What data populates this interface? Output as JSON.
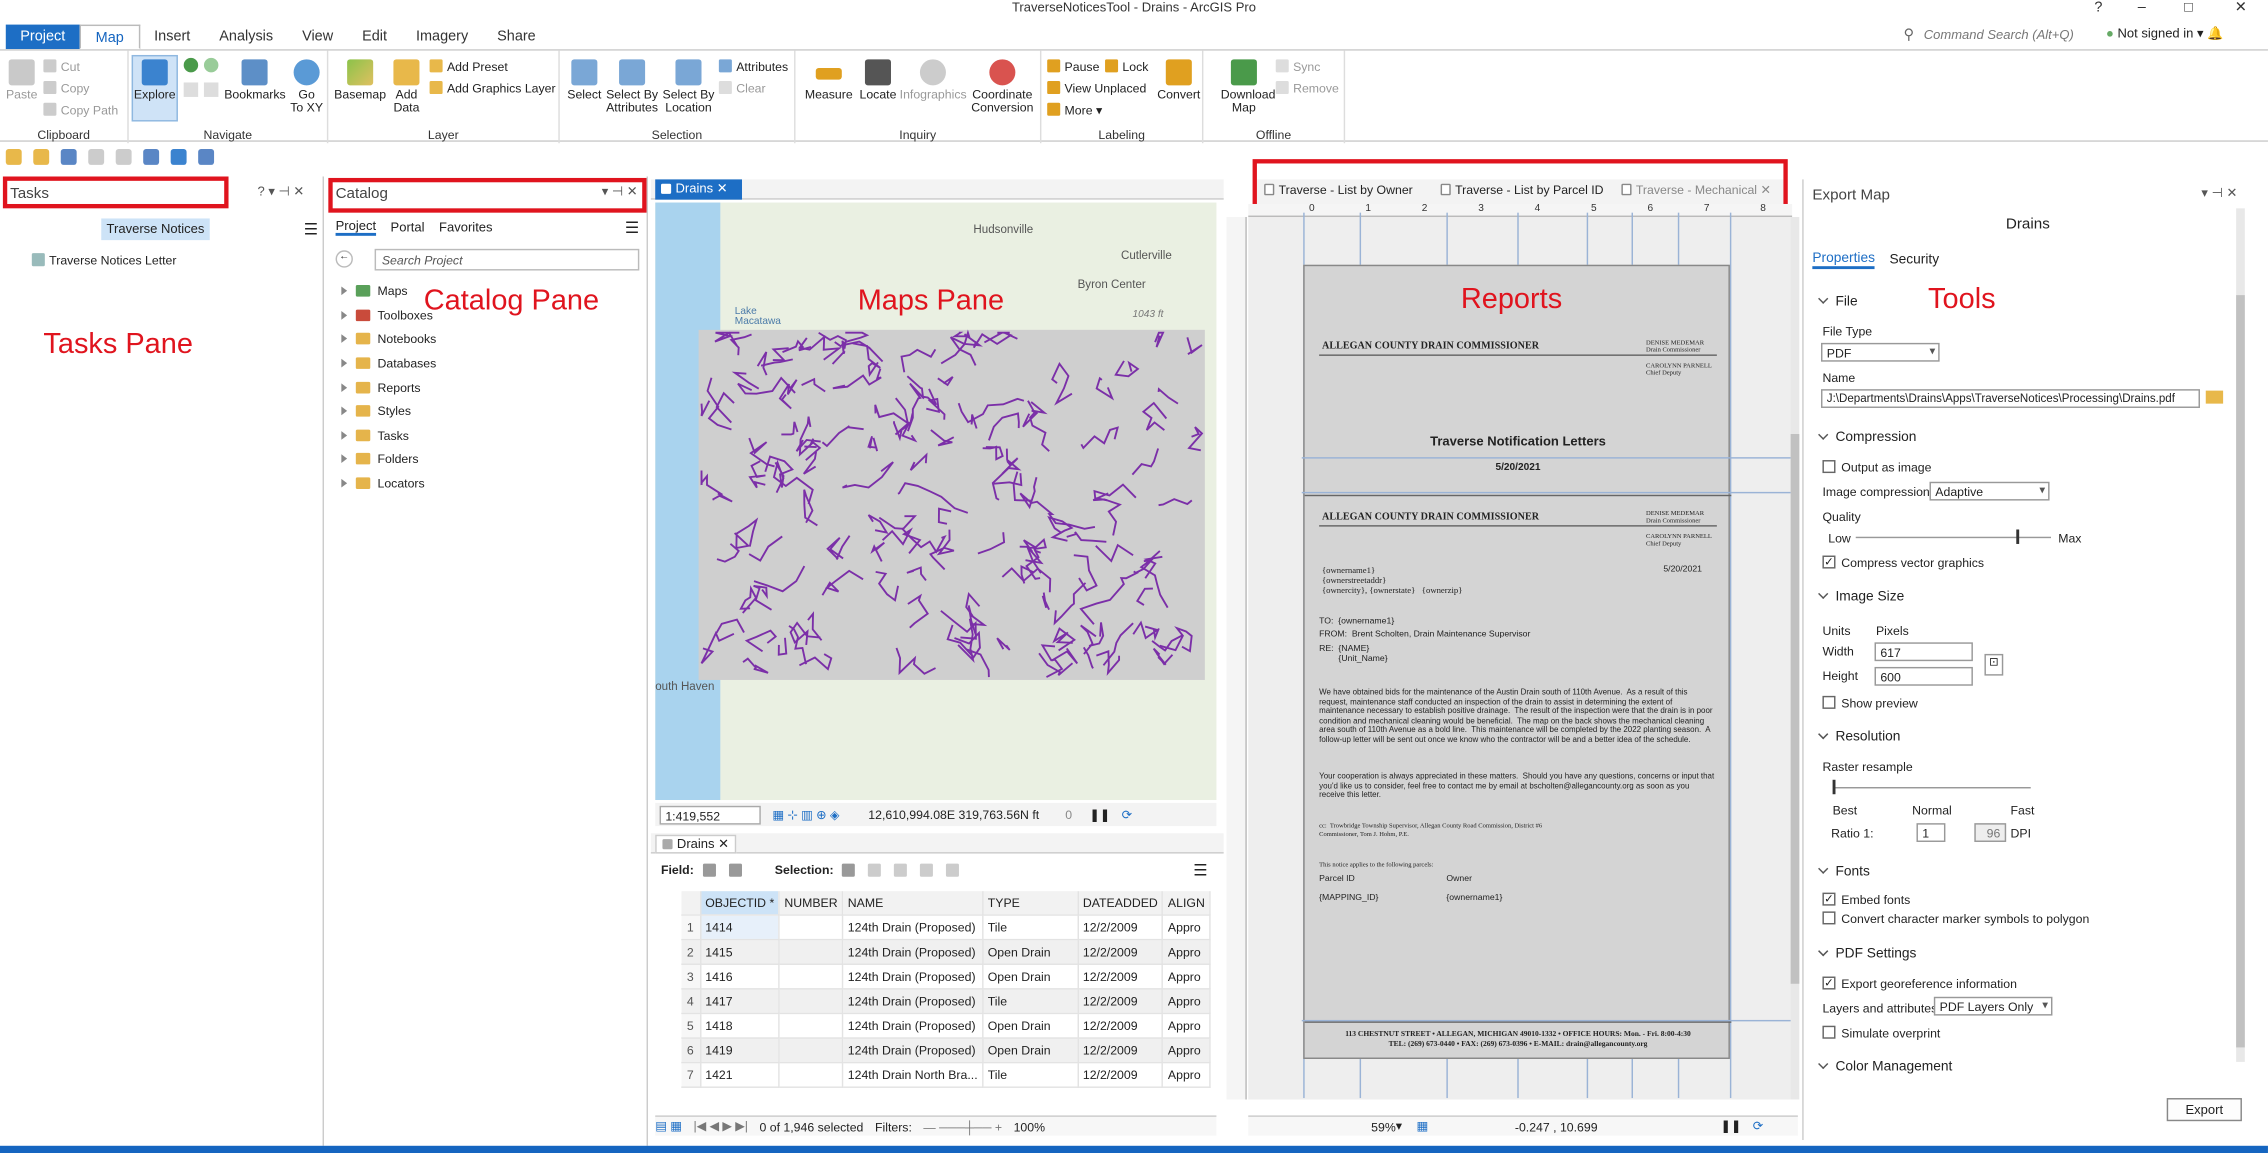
{
  "title_bar": {
    "title": "TraverseNoticesTool - Drains - ArcGIS Pro",
    "help": "?",
    "minimize": "–",
    "maximize": "□",
    "close": "✕"
  },
  "ribbon_tabs": [
    "Project",
    "Map",
    "Insert",
    "Analysis",
    "View",
    "Edit",
    "Imagery",
    "Share"
  ],
  "command_search_placeholder": "Command Search (Alt+Q)",
  "sign_in": "Not signed in",
  "ribbon": {
    "clipboard": {
      "name": "Clipboard",
      "paste": "Paste",
      "cut": "Cut",
      "copy": "Copy",
      "copy_path": "Copy Path"
    },
    "navigate": {
      "name": "Navigate",
      "explore": "Explore",
      "bookmarks": "Bookmarks",
      "goto": "Go\nTo XY"
    },
    "layer": {
      "name": "Layer",
      "basemap": "Basemap",
      "add_data": "Add\nData",
      "add_preset": "Add Preset",
      "add_graphics": "Add Graphics Layer"
    },
    "selection": {
      "name": "Selection",
      "select": "Select",
      "select_by_attr": "Select By\nAttributes",
      "select_by_loc": "Select By\nLocation",
      "attributes": "Attributes",
      "clear": "Clear"
    },
    "inquiry": {
      "name": "Inquiry",
      "measure": "Measure",
      "locate": "Locate",
      "infographics": "Infographics",
      "coord_conv": "Coordinate\nConversion"
    },
    "labeling": {
      "name": "Labeling",
      "pause": "Pause",
      "lock": "Lock",
      "view_unplaced": "View Unplaced",
      "more": "More",
      "convert": "Convert"
    },
    "offline": {
      "name": "Offline",
      "download_map": "Download\nMap",
      "sync": "Sync",
      "remove": "Remove"
    }
  },
  "tasks_pane": {
    "title": "Tasks",
    "task_name": "Traverse Notices",
    "item": "Traverse Notices Letter"
  },
  "catalog_pane": {
    "title": "Catalog",
    "tabs": [
      "Project",
      "Portal",
      "Favorites"
    ],
    "search_placeholder": "Search Project",
    "items": [
      "Maps",
      "Toolboxes",
      "Notebooks",
      "Databases",
      "Reports",
      "Styles",
      "Tasks",
      "Folders",
      "Locators"
    ]
  },
  "map_view": {
    "tab": "Drains",
    "labels": {
      "hudsonville": "Hudsonville",
      "cutlerville": "Cutlerville",
      "byron": "Byron Center",
      "lake": "Lake\nMacatawa",
      "south_haven": "outh Haven",
      "road": "1043 ft"
    },
    "scale": "1:419,552",
    "coords": "12,610,994.08E 319,763.56N ft",
    "selected_count": "0"
  },
  "attribute_table": {
    "tab": "Drains",
    "field_label": "Field:",
    "selection_label": "Selection:",
    "columns": [
      "OBJECTID *",
      "NUMBER",
      "NAME",
      "TYPE",
      "DATEADDED",
      "ALIGN"
    ],
    "rows": [
      [
        "1",
        "1414",
        "",
        "124th Drain (Proposed)",
        "Tile",
        "12/2/2009",
        "Appro"
      ],
      [
        "2",
        "1415",
        "",
        "124th Drain (Proposed)",
        "Open Drain",
        "12/2/2009",
        "Appro"
      ],
      [
        "3",
        "1416",
        "",
        "124th Drain (Proposed)",
        "Open Drain",
        "12/2/2009",
        "Appro"
      ],
      [
        "4",
        "1417",
        "",
        "124th Drain (Proposed)",
        "Tile",
        "12/2/2009",
        "Appro"
      ],
      [
        "5",
        "1418",
        "",
        "124th Drain (Proposed)",
        "Open Drain",
        "12/2/2009",
        "Appro"
      ],
      [
        "6",
        "1419",
        "",
        "124th Drain (Proposed)",
        "Open Drain",
        "12/2/2009",
        "Appro"
      ],
      [
        "7",
        "1421",
        "",
        "124th Drain North Bra...",
        "Tile",
        "12/2/2009",
        "Appro"
      ]
    ],
    "status": "0 of 1,946 selected",
    "filters": "Filters:",
    "zoom": "100%"
  },
  "report_tabs": [
    "Traverse - List by Owner",
    "Traverse - List by Parcel ID",
    "Traverse - Mechanical"
  ],
  "report": {
    "header": "ALLEGAN COUNTY DRAIN COMMISSIONER",
    "side1": "DENISE MEDEMAR\nDrain Commissioner",
    "side2": "CAROLYNN PARNELL\nChief Deputy",
    "title": "Traverse Notification Letters",
    "date": "5/20/2021",
    "address_block": "{ownername1}\n{ownerstreetaddr}\n{ownercity}, {ownerstate}   {ownerzip}",
    "to": "TO:  {ownername1}",
    "from": "FROM:  Brent Scholten, Drain Maintenance Supervisor",
    "re": "RE:  {NAME}\n        {Unit_Name}",
    "body1": "We have obtained bids for the maintenance of the Austin Drain south of 110th Avenue.  As a result of this request, maintenance staff conducted an inspection of the drain to assist in determining the extent of maintenance necessary to establish positive drainage.  The result of the inspection were that the drain is in poor condition and mechanical cleaning would be beneficial.  The map on the back shows the mechanical cleaning area south of 110th Avenue as a bold line.  This maintenance will be completed by the 2022 planting season.  A follow-up letter will be sent out once we know who the contractor will be and a better idea of the schedule.",
    "body2": "Your cooperation is always appreciated in these matters.  Should you have any questions, concerns or input that you'd like us to consider, feel free to contact me by email at bscholten@allegancounty.org as soon as you receive this letter.",
    "cc": "cc:  Trowbridge Township Supervisor, Allegan County Road Commission, District #6\nCommissioner, Tom J. Hohm, P.E.",
    "notice": "This notice applies to the following parcels:",
    "col1": "Parcel ID",
    "col2": "Owner",
    "val1": "{MAPPING_ID}",
    "val2": "{ownername1}",
    "footer": "113 CHESTNUT STREET • ALLEGAN, MICHIGAN 49010-1332 • OFFICE HOURS: Mon. - Fri. 8:00-4:30\nTEL: (269) 673-0440 • FAX: (269) 673-0396 • E-MAIL: drain@allegancounty.org",
    "zoom": "59%",
    "coords": "-0.247 , 10.699",
    "ruler": [
      "0",
      "1",
      "2",
      "3",
      "4",
      "5",
      "6",
      "7",
      "8"
    ]
  },
  "export_map": {
    "title": "Export Map",
    "subtitle": "Drains",
    "tabs": [
      "Properties",
      "Security"
    ],
    "file_section": "File",
    "file_type_label": "File Type",
    "file_type": "PDF",
    "name_label": "Name",
    "name_value": "J:\\Departments\\Drains\\Apps\\TraverseNotices\\Processing\\Drains.pdf",
    "compression_section": "Compression",
    "output_as_image": "Output as image",
    "image_compression_label": "Image compression",
    "image_compression": "Adaptive",
    "quality_label": "Quality",
    "quality_low": "Low",
    "quality_max": "Max",
    "quality": 0.82,
    "compress_vector": "Compress vector graphics",
    "image_size_section": "Image Size",
    "units_label": "Units",
    "units": "Pixels",
    "width_label": "Width",
    "width": "617",
    "height_label": "Height",
    "height": "600",
    "show_preview": "Show preview",
    "resolution_section": "Resolution",
    "raster_resample": "Raster resample",
    "best": "Best",
    "normal": "Normal",
    "fast": "Fast",
    "ratio_label": "Ratio 1:",
    "ratio": "1",
    "dpi_value": "96",
    "dpi_label": "DPI",
    "fonts_section": "Fonts",
    "embed_fonts": "Embed fonts",
    "convert_marker": "Convert character marker symbols to polygon",
    "pdf_section": "PDF Settings",
    "export_georef": "Export georeference information",
    "layers_label": "Layers and attributes",
    "layers_value": "PDF Layers Only",
    "simulate_overprint": "Simulate overprint",
    "color_section": "Color Management",
    "export_button": "Export"
  },
  "annotations": {
    "tasks": "Tasks Pane",
    "catalog": "Catalog Pane",
    "maps": "Maps Pane",
    "reports": "Reports",
    "tools": "Tools"
  },
  "colors": {
    "accent": "#1d6ec5",
    "annotation_red": "#e0141e",
    "drain_purple": "#7b2fa8"
  }
}
